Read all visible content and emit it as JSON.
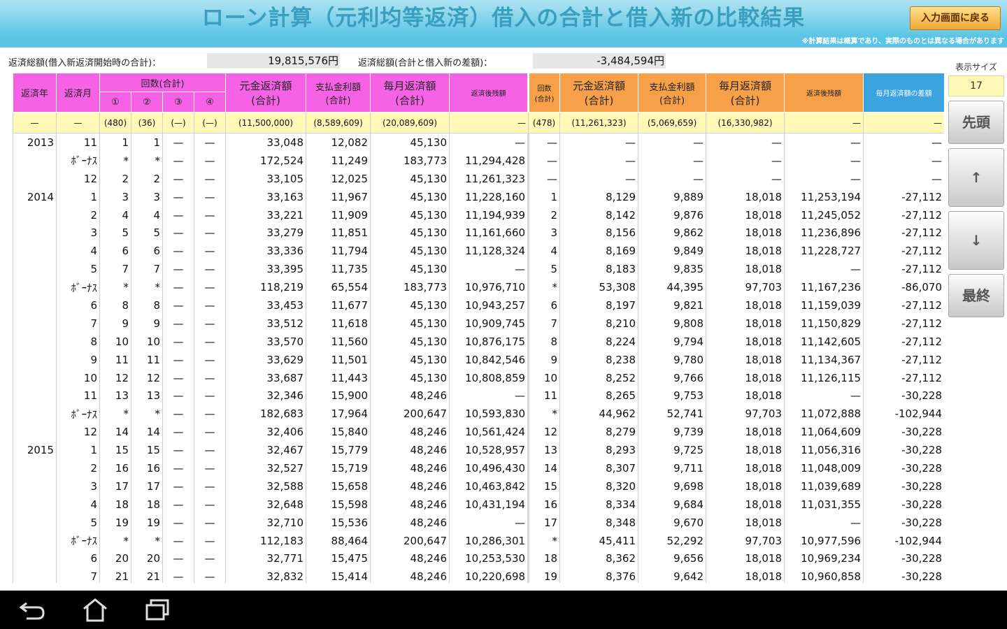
{
  "header": {
    "title": "ローン計算（元利均等返済）借入の合計と借入新の比較結果",
    "back_label": "入力画面に戻る",
    "notice": "※計算結果は概算であり、実際のものとは異なる場合があります"
  },
  "summary": {
    "label1": "返済総額(借入新返済開始時の合計)：",
    "value1": "19,815,576円",
    "label2": "返済総額(合計と借入新の差額)：",
    "value2": "-3,484,594円"
  },
  "side": {
    "size_label": "表示サイズ",
    "size_value": "17",
    "first": "先頭",
    "up": "↑",
    "down": "↓",
    "last": "最終"
  },
  "table": {
    "left_group_header": "回数(合計)",
    "headers": {
      "year": "返済年",
      "month": "返済月",
      "n1": "①",
      "n2": "②",
      "n3": "③",
      "n4": "④",
      "principal": "元金返済額\n(合計)",
      "interest": "支払金利額\n(合計)",
      "monthly": "毎月返済額\n(合計)",
      "balance": "返済後残額",
      "new_count": "回数\n(合計)",
      "new_principal": "元金返済額\n(合計)",
      "new_interest": "支払金利額\n(合計)",
      "new_monthly": "毎月返済額\n(合計)",
      "new_balance": "返済後残額",
      "diff": "毎月返済額の差額"
    },
    "totals": [
      "—",
      "—",
      "(480)",
      "(36)",
      "(—)",
      "(—)",
      "(11,500,000)",
      "(8,589,609)",
      "(20,089,609)",
      "—",
      "(478)",
      "(11,261,323)",
      "(5,069,659)",
      "(16,330,982)",
      "—",
      "—"
    ],
    "rows": [
      [
        "2013",
        "11",
        "1",
        "1",
        "—",
        "—",
        "33,048",
        "12,082",
        "45,130",
        "—",
        "—",
        "—",
        "—",
        "—",
        "—",
        "—"
      ],
      [
        "",
        "ﾎﾞｰﾅｽ",
        "*",
        "*",
        "—",
        "—",
        "172,524",
        "11,249",
        "183,773",
        "11,294,428",
        "—",
        "—",
        "—",
        "—",
        "—",
        "—"
      ],
      [
        "",
        "12",
        "2",
        "2",
        "—",
        "—",
        "33,105",
        "12,025",
        "45,130",
        "11,261,323",
        "—",
        "—",
        "—",
        "—",
        "—",
        "—"
      ],
      [
        "2014",
        "1",
        "3",
        "3",
        "—",
        "—",
        "33,163",
        "11,967",
        "45,130",
        "11,228,160",
        "1",
        "8,129",
        "9,889",
        "18,018",
        "11,253,194",
        "-27,112"
      ],
      [
        "",
        "2",
        "4",
        "4",
        "—",
        "—",
        "33,221",
        "11,909",
        "45,130",
        "11,194,939",
        "2",
        "8,142",
        "9,876",
        "18,018",
        "11,245,052",
        "-27,112"
      ],
      [
        "",
        "3",
        "5",
        "5",
        "—",
        "—",
        "33,279",
        "11,851",
        "45,130",
        "11,161,660",
        "3",
        "8,156",
        "9,862",
        "18,018",
        "11,236,896",
        "-27,112"
      ],
      [
        "",
        "4",
        "6",
        "6",
        "—",
        "—",
        "33,336",
        "11,794",
        "45,130",
        "11,128,324",
        "4",
        "8,169",
        "9,849",
        "18,018",
        "11,228,727",
        "-27,112"
      ],
      [
        "",
        "5",
        "7",
        "7",
        "—",
        "—",
        "33,395",
        "11,735",
        "45,130",
        "—",
        "5",
        "8,183",
        "9,835",
        "18,018",
        "—",
        "-27,112"
      ],
      [
        "",
        "ﾎﾞｰﾅｽ",
        "*",
        "*",
        "—",
        "—",
        "118,219",
        "65,554",
        "183,773",
        "10,976,710",
        "*",
        "53,308",
        "44,395",
        "97,703",
        "11,167,236",
        "-86,070"
      ],
      [
        "",
        "6",
        "8",
        "8",
        "—",
        "—",
        "33,453",
        "11,677",
        "45,130",
        "10,943,257",
        "6",
        "8,197",
        "9,821",
        "18,018",
        "11,159,039",
        "-27,112"
      ],
      [
        "",
        "7",
        "9",
        "9",
        "—",
        "—",
        "33,512",
        "11,618",
        "45,130",
        "10,909,745",
        "7",
        "8,210",
        "9,808",
        "18,018",
        "11,150,829",
        "-27,112"
      ],
      [
        "",
        "8",
        "10",
        "10",
        "—",
        "—",
        "33,570",
        "11,560",
        "45,130",
        "10,876,175",
        "8",
        "8,224",
        "9,794",
        "18,018",
        "11,142,605",
        "-27,112"
      ],
      [
        "",
        "9",
        "11",
        "11",
        "—",
        "—",
        "33,629",
        "11,501",
        "45,130",
        "10,842,546",
        "9",
        "8,238",
        "9,780",
        "18,018",
        "11,134,367",
        "-27,112"
      ],
      [
        "",
        "10",
        "12",
        "12",
        "—",
        "—",
        "33,687",
        "11,443",
        "45,130",
        "10,808,859",
        "10",
        "8,252",
        "9,766",
        "18,018",
        "11,126,115",
        "-27,112"
      ],
      [
        "",
        "11",
        "13",
        "13",
        "—",
        "—",
        "32,346",
        "15,900",
        "48,246",
        "—",
        "11",
        "8,265",
        "9,753",
        "18,018",
        "—",
        "-30,228"
      ],
      [
        "",
        "ﾎﾞｰﾅｽ",
        "*",
        "*",
        "—",
        "—",
        "182,683",
        "17,964",
        "200,647",
        "10,593,830",
        "*",
        "44,962",
        "52,741",
        "97,703",
        "11,072,888",
        "-102,944"
      ],
      [
        "",
        "12",
        "14",
        "14",
        "—",
        "—",
        "32,406",
        "15,840",
        "48,246",
        "10,561,424",
        "12",
        "8,279",
        "9,739",
        "18,018",
        "11,064,609",
        "-30,228"
      ],
      [
        "2015",
        "1",
        "15",
        "15",
        "—",
        "—",
        "32,467",
        "15,779",
        "48,246",
        "10,528,957",
        "13",
        "8,293",
        "9,725",
        "18,018",
        "11,056,316",
        "-30,228"
      ],
      [
        "",
        "2",
        "16",
        "16",
        "—",
        "—",
        "32,527",
        "15,719",
        "48,246",
        "10,496,430",
        "14",
        "8,307",
        "9,711",
        "18,018",
        "11,048,009",
        "-30,228"
      ],
      [
        "",
        "3",
        "17",
        "17",
        "—",
        "—",
        "32,588",
        "15,658",
        "48,246",
        "10,463,842",
        "15",
        "8,320",
        "9,698",
        "18,018",
        "11,039,689",
        "-30,228"
      ],
      [
        "",
        "4",
        "18",
        "18",
        "—",
        "—",
        "32,648",
        "15,598",
        "48,246",
        "10,431,194",
        "16",
        "8,334",
        "9,684",
        "18,018",
        "11,031,355",
        "-30,228"
      ],
      [
        "",
        "5",
        "19",
        "19",
        "—",
        "—",
        "32,710",
        "15,536",
        "48,246",
        "—",
        "17",
        "8,348",
        "9,670",
        "18,018",
        "—",
        "-30,228"
      ],
      [
        "",
        "ﾎﾞｰﾅｽ",
        "*",
        "*",
        "—",
        "—",
        "112,183",
        "88,464",
        "200,647",
        "10,286,301",
        "*",
        "45,411",
        "52,292",
        "97,703",
        "10,977,596",
        "-102,944"
      ],
      [
        "",
        "6",
        "20",
        "20",
        "—",
        "—",
        "32,771",
        "15,475",
        "48,246",
        "10,253,530",
        "18",
        "8,362",
        "9,656",
        "18,018",
        "10,969,234",
        "-30,228"
      ],
      [
        "",
        "7",
        "21",
        "21",
        "—",
        "—",
        "32,832",
        "15,414",
        "48,246",
        "10,220,698",
        "19",
        "8,376",
        "9,642",
        "18,018",
        "10,960,858",
        "-30,228"
      ]
    ]
  },
  "navbar": {
    "back": "back-icon",
    "home": "home-icon",
    "recent": "recent-apps-icon"
  }
}
